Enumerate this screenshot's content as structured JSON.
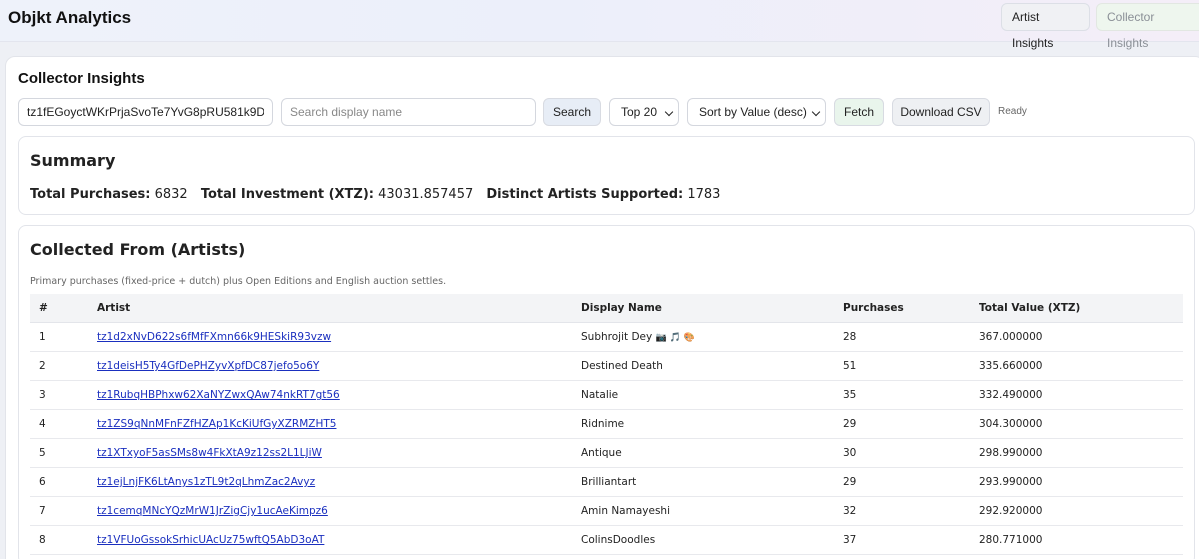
{
  "app": {
    "title": "Objkt Analytics",
    "tabs": [
      {
        "label": "Artist Insights"
      },
      {
        "label": "Collector Insights"
      }
    ]
  },
  "controls": {
    "section_title": "Collector Insights",
    "address_value": "tz1fEGoyctWKrPrjaSvoTe7YvG8pRU581k9D",
    "search_placeholder": "Search display name",
    "search_label": "Search",
    "top_selected": "Top 20",
    "sort_selected": "Sort by Value (desc)",
    "fetch_label": "Fetch",
    "csv_label": "Download CSV",
    "status": "Ready"
  },
  "summary": {
    "title": "Summary",
    "purchases_label": "Total Purchases:",
    "purchases_value": "6832",
    "investment_label": "Total Investment (XTZ):",
    "investment_value": "43031.857457",
    "artists_label": "Distinct Artists Supported:",
    "artists_value": "1783"
  },
  "artists": {
    "title": "Collected From (Artists)",
    "note": "Primary purchases (fixed-price + dutch) plus Open Editions and English auction settles.",
    "columns": [
      "#",
      "Artist",
      "Display Name",
      "Purchases",
      "Total Value (XTZ)"
    ],
    "rows": [
      {
        "n": "1",
        "artist": "tz1d2xNvD622s6fMfFXmn66k9HESkiR93vzw",
        "name": "Subhrojit Dey",
        "emoji": "📷 🎵 🎨",
        "purchases": "28",
        "value": "367.000000"
      },
      {
        "n": "2",
        "artist": "tz1deisH5Ty4GfDePHZyvXpfDC87jefo5o6Y",
        "name": "Destined Death",
        "emoji": "",
        "purchases": "51",
        "value": "335.660000"
      },
      {
        "n": "3",
        "artist": "tz1RubqHBPhxw62XaNYZwxQAw74nkRT7gt56",
        "name": "Natalie",
        "emoji": "",
        "purchases": "35",
        "value": "332.490000"
      },
      {
        "n": "4",
        "artist": "tz1ZS9qNnMFnFZfHZAp1KcKiUfGyXZRMZHT5",
        "name": "Ridnime",
        "emoji": "",
        "purchases": "29",
        "value": "304.300000"
      },
      {
        "n": "5",
        "artist": "tz1XTxyoF5asSMs8w4FkXtA9z12ss2L1LJiW",
        "name": "Antique",
        "emoji": "",
        "purchases": "30",
        "value": "298.990000"
      },
      {
        "n": "6",
        "artist": "tz1ejLnjFK6LtAnys1zTL9t2qLhmZac2Avyz",
        "name": "Brilliantart",
        "emoji": "",
        "purchases": "29",
        "value": "293.990000"
      },
      {
        "n": "7",
        "artist": "tz1cemqMNcYQzMrW1JrZigCjy1ucAeKimpz6",
        "name": "Amin Namayeshi",
        "emoji": "",
        "purchases": "32",
        "value": "292.920000"
      },
      {
        "n": "8",
        "artist": "tz1VFUoGssokSrhicUAcUz75wftQ5AbD3oAT",
        "name": "ColinsDoodles",
        "emoji": "",
        "purchases": "37",
        "value": "280.771000"
      }
    ]
  }
}
